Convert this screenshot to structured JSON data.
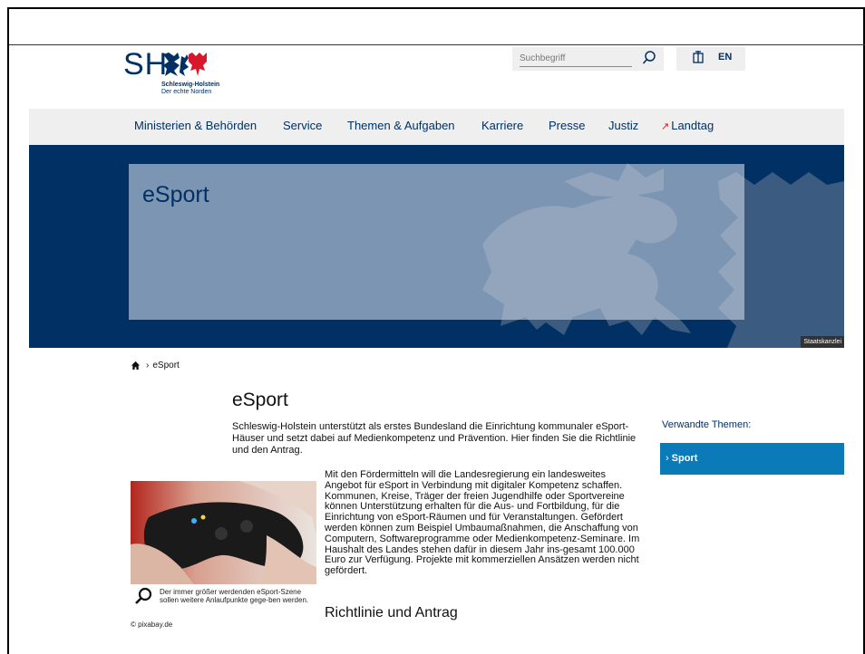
{
  "header": {
    "logo_letters": "SH",
    "logo_name": "Schleswig-Holstein",
    "logo_tagline": "Der echte Norden",
    "search_placeholder": "Suchbegriff",
    "lang_label": "EN"
  },
  "nav": {
    "items": [
      {
        "label": "Ministerien & Behörden"
      },
      {
        "label": "Service"
      },
      {
        "label": "Themen & Aufgaben"
      },
      {
        "label": "Karriere"
      },
      {
        "label": "Presse"
      },
      {
        "label": "Justiz"
      },
      {
        "label": "Landtag",
        "external_marker": "↗"
      }
    ]
  },
  "hero": {
    "title": "eSport",
    "credit": "Staatskanzlei"
  },
  "breadcrumb": {
    "current": "eSport"
  },
  "main": {
    "title": "eSport",
    "intro": "Schleswig-Holstein unterstützt als erstes Bundesland die Einrichtung kommunaler eSport-Häuser und setzt dabei auf Medienkompetenz und Prävention. Hier finden Sie die Richtlinie und den Antrag.",
    "body": "Mit den Fördermitteln will die Landesregierung ein landesweites Angebot für eSport in Verbindung mit digitaler Kompetenz schaffen. Kommunen, Kreise, Träger der freien Jugendhilfe oder Sportvereine können Unterstützung erhalten für die Aus- und Fortbildung, für die Einrichtung von eSport-Räumen und für Veranstaltungen. Gefördert werden können zum Beispiel Umbaumaßnahmen, die Anschaffung von Computern, Softwareprogramme oder Medienkompetenz-Seminare. Im Haushalt des Landes stehen dafür in diesem Jahr ins-gesamt 100.000 Euro zur Verfügung. Projekte mit kommerziellen Ansätzen werden nicht gefördert.",
    "caption": "Der immer größer werdenden eSport-Szene sollen weitere Anlaufpunkte gege-ben werden.",
    "copyright": "© pixabay.de",
    "subheading": "Richtlinie und Antrag"
  },
  "sidebar": {
    "title": "Verwandte Themen:",
    "items": [
      {
        "label": "Sport",
        "chevron": "›"
      }
    ]
  },
  "colors": {
    "brand_navy": "#003064",
    "nav_bg": "#efefef",
    "related_blue": "#0a7ab8",
    "external_red": "#dd1111"
  }
}
